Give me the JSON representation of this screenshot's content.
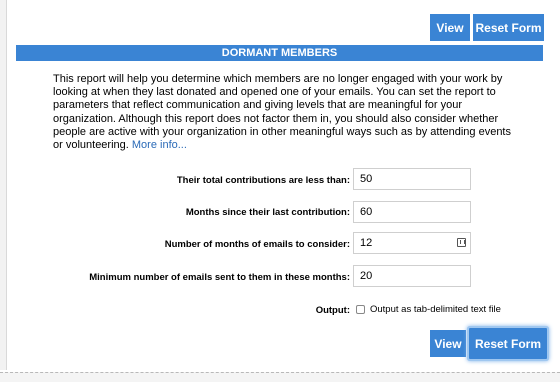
{
  "toolbar_top": {
    "view_label": "View",
    "reset_label": "Reset Form"
  },
  "section": {
    "title": "DORMANT MEMBERS"
  },
  "description": {
    "text": "This report will help you determine which members are no longer engaged with your work by looking at when they last donated and opened one of your emails. You can set the report to parameters that reflect communication and giving levels that are meaningful for your organization. Although this report does not factor them in, you should also consider whether people are active with your organization in other meaningful ways such as by attending events or volunteering.",
    "link": "More info..."
  },
  "form": {
    "contributions": {
      "label": "Their total contributions are less than:",
      "value": "50"
    },
    "months_since": {
      "label": "Months since their last contribution:",
      "value": "60"
    },
    "months_emails": {
      "label": "Number of months of emails to consider:",
      "value": "12"
    },
    "min_emails": {
      "label": "Minimum number of emails sent to them in these months:",
      "value": "20"
    },
    "output": {
      "label": "Output:",
      "checkbox_label": "Output as tab-delimited text file",
      "checked": false
    }
  },
  "toolbar_bottom": {
    "view_label": "View",
    "reset_label": "Reset Form"
  },
  "colors": {
    "accent": "#3a84d4",
    "link": "#2a6ab7"
  },
  "icons": {
    "stepper": "spinner-icon"
  }
}
